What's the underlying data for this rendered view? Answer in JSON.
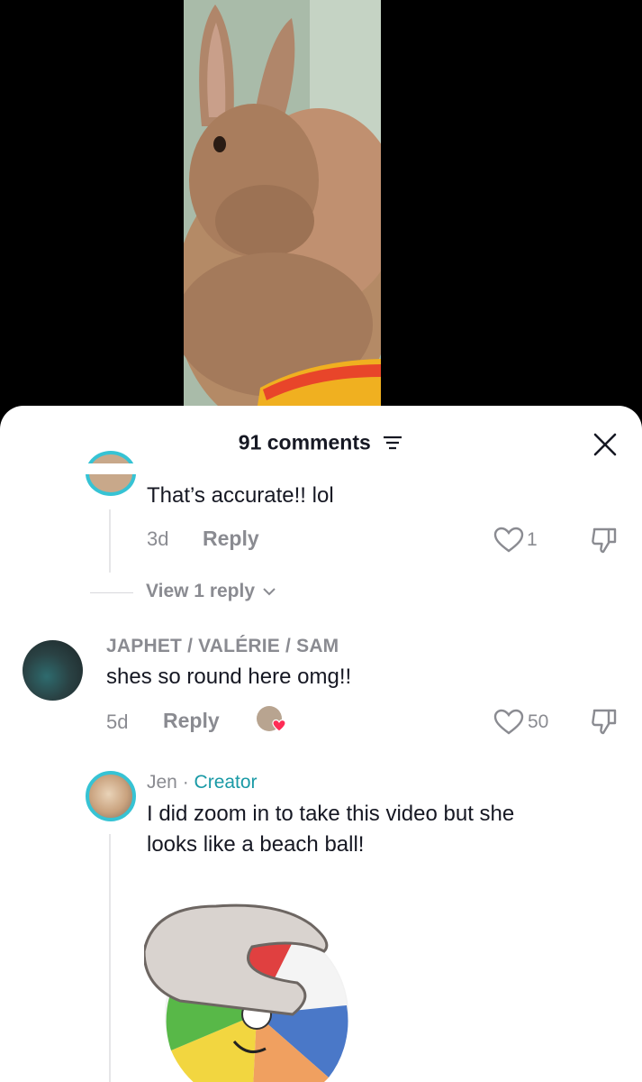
{
  "video": {
    "description_icon": "rabbit-video-icon"
  },
  "comments_sheet": {
    "count_label": "91 comments",
    "sort_icon": "filter-lines-icon",
    "close_icon": "close-icon"
  },
  "comments": [
    {
      "text": "That’s accurate!! lol",
      "time": "3d",
      "reply_label": "Reply",
      "likes": "1",
      "view_replies": "View 1 reply"
    },
    {
      "username": "JAPHET / VALÉRIE / SAM",
      "text": "shes so round here omg!!",
      "time": "5d",
      "reply_label": "Reply",
      "likes": "50"
    },
    {
      "username": "Jen",
      "separator": " · ",
      "badge": "Creator",
      "text_line1": "I did zoom in to take this video but she",
      "text_line2": "looks like a beach ball!"
    }
  ],
  "colors": {
    "creator": "#1a9aa6",
    "avatar_ring": "#36c3d4",
    "heart": "#fe2c55"
  }
}
